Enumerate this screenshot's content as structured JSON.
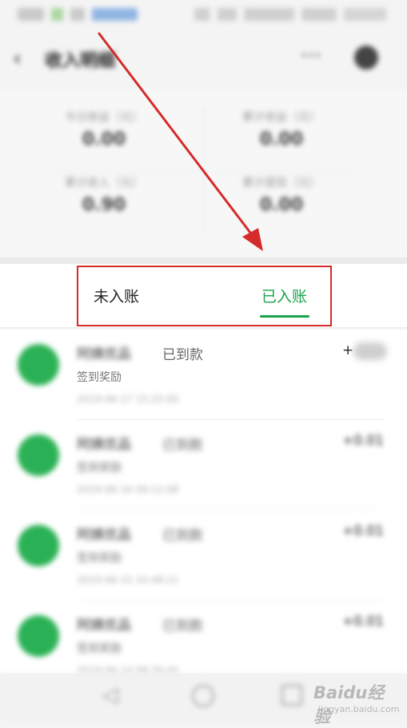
{
  "header": {
    "title": "收入明细",
    "back_icon": "back-arrow-icon",
    "more_icon": "more-icon",
    "settings_icon": "settings-icon"
  },
  "stats": [
    {
      "label": "今日收益（元）",
      "value": "0.00"
    },
    {
      "label": "累计收益（元）",
      "value": "0.00"
    },
    {
      "label": "累计收入（元）",
      "value": "0.90"
    },
    {
      "label": "累计提现（元）",
      "value": "0.00"
    }
  ],
  "tabs": {
    "unbooked": "未入账",
    "booked": "已入账",
    "active_color": "#1aa34a"
  },
  "items": [
    {
      "name": "阿姨优品",
      "status": "已到款",
      "amount": "+",
      "sub": "签到奖励",
      "date": "2019-06-17 15:25:00",
      "blurred": false
    },
    {
      "name": "阿姨优品",
      "status": "已到款",
      "amount": "+0.01",
      "sub": "签到奖励",
      "date": "2019-06-16 09:12:08",
      "blurred": true
    },
    {
      "name": "阿姨优品",
      "status": "已到款",
      "amount": "+0.01",
      "sub": "签到奖励",
      "date": "2019-06-15 10:48:21",
      "blurred": true
    },
    {
      "name": "阿姨优品",
      "status": "已到款",
      "amount": "+0.01",
      "sub": "签到奖励",
      "date": "2019-06-14 08:30:45",
      "blurred": true
    }
  ],
  "nav": {
    "back_icon": "nav-back-icon",
    "home_icon": "nav-home-icon",
    "recent_icon": "nav-recent-icon"
  },
  "watermark": {
    "brand": "Baidu经验",
    "url": "jingyan.baidu.com"
  },
  "colors": {
    "accent": "#1aa34a",
    "annotation": "#d52b2b",
    "avatar": "#2bb155"
  }
}
